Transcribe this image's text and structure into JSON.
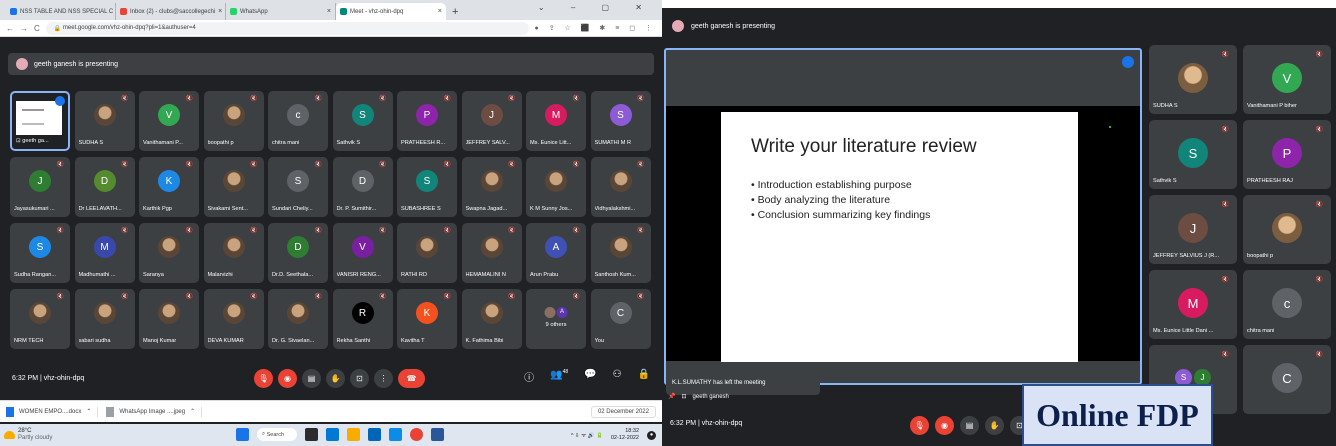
{
  "browser": {
    "tabs": [
      {
        "label": "NSS TABLE AND NSS SPECIAL C",
        "color": "#1a73e8"
      },
      {
        "label": "Inbox (2) - clubs@saccollegechi",
        "color": "#ea4335"
      },
      {
        "label": "WhatsApp",
        "color": "#25d366"
      },
      {
        "label": "Meet - vhz-ohin-dpq",
        "color": "#00897b"
      }
    ],
    "url": "meet.google.com/vhz-ohin-dpq?pli=1&authuser=4"
  },
  "left": {
    "presenting": "geeth ganesh is presenting",
    "presenter_tile": "geeth ga...",
    "tiles": [
      {
        "name": "SUDHA S",
        "initial": "",
        "color": "photo"
      },
      {
        "name": "Vanithamani P...",
        "initial": "V",
        "color": "#33a852"
      },
      {
        "name": "boopathi p",
        "initial": "",
        "color": "photo"
      },
      {
        "name": "chitra mani",
        "initial": "c",
        "color": "#5f6368"
      },
      {
        "name": "Sathvik S",
        "initial": "S",
        "color": "#12857a"
      },
      {
        "name": "PRATHEESH R...",
        "initial": "P",
        "color": "#8e24aa"
      },
      {
        "name": "JEFFREY SALV...",
        "initial": "J",
        "color": "#6d4c41"
      },
      {
        "name": "Ms. Eunice Litt...",
        "initial": "M",
        "color": "#d81b60"
      },
      {
        "name": "SUMATHI M R",
        "initial": "S",
        "color": "#8e5bd6"
      },
      {
        "name": "Jayasukumari ...",
        "initial": "J",
        "color": "#2e7d32"
      },
      {
        "name": "Dr LEELAVATH...",
        "initial": "D",
        "color": "#558b2f"
      },
      {
        "name": "Karthik Pgp",
        "initial": "K",
        "color": "#1e88e5"
      },
      {
        "name": "Sivakami Sent...",
        "initial": "",
        "color": "photo"
      },
      {
        "name": "Sundari Cheliy...",
        "initial": "S",
        "color": "#5f6368"
      },
      {
        "name": "Dr. P. Sumithir...",
        "initial": "D",
        "color": "#5f6368"
      },
      {
        "name": "SUBASHREE S",
        "initial": "S",
        "color": "#12857a"
      },
      {
        "name": "Swapna Jagad...",
        "initial": "",
        "color": "photo"
      },
      {
        "name": "K M Sunny Jos...",
        "initial": "",
        "color": "photo"
      },
      {
        "name": "Vidhyalakshmi...",
        "initial": "",
        "color": "photo"
      },
      {
        "name": "Sudha Rangan...",
        "initial": "S",
        "color": "#1e88e5"
      },
      {
        "name": "Madhumathi ...",
        "initial": "M",
        "color": "#3949ab"
      },
      {
        "name": "Saranya",
        "initial": "",
        "color": "photo"
      },
      {
        "name": "Malarvizhi",
        "initial": "",
        "color": "photo"
      },
      {
        "name": "Dr.D. Seethala...",
        "initial": "D",
        "color": "#2e7d32"
      },
      {
        "name": "VANISRI RENG...",
        "initial": "V",
        "color": "#7b1fa2"
      },
      {
        "name": "RATHI RD",
        "initial": "",
        "color": "photo"
      },
      {
        "name": "HEMAMALINI N",
        "initial": "",
        "color": "photo"
      },
      {
        "name": "Arun Prabu",
        "initial": "A",
        "color": "#3f51b5"
      },
      {
        "name": "Santhosh Kum...",
        "initial": "",
        "color": "photo"
      },
      {
        "name": "NRM TECH",
        "initial": "",
        "color": "photo"
      },
      {
        "name": "sabari sudha",
        "initial": "",
        "color": "photo"
      },
      {
        "name": "Manoj Kumar",
        "initial": "",
        "color": "photo"
      },
      {
        "name": "DEVA KUMAR",
        "initial": "",
        "color": "photo"
      },
      {
        "name": "Dr. G. Sivaelan...",
        "initial": "",
        "color": "photo"
      },
      {
        "name": "Rekha Santhi",
        "initial": "R",
        "color": "#000000"
      },
      {
        "name": "Kavitha T",
        "initial": "K",
        "color": "#f4511e"
      },
      {
        "name": "K. Fathima Bibi",
        "initial": "",
        "color": "photo"
      },
      {
        "name": "9 others",
        "initial": "more",
        "color": ""
      },
      {
        "name": "You",
        "initial": "C",
        "color": "#5f6368"
      }
    ],
    "meeting_info": "6:32 PM  |  vhz-ohin-dpq",
    "participants_badge": "48",
    "downloads": [
      "WOMEN EMPO....docx",
      "WhatsApp Image ....jpeg"
    ],
    "date_chip": "02 December 2022",
    "weather": {
      "temp": "28°C",
      "desc": "Partly cloudy"
    },
    "search": "Search",
    "clock": {
      "time": "18:32",
      "date": "02-12-2022"
    }
  },
  "right": {
    "presenting": "geeth ganesh is presenting",
    "slide": {
      "title": "Write your literature review",
      "bullets": [
        "Introduction establishing purpose",
        "Body analyzing the literature",
        "Conclusion summarizing key findings"
      ]
    },
    "notification": "K.L.SUMATHY has left the meeting",
    "presenter_strip": "geeth ganesh",
    "meeting_info": "6:32 PM  |  vhz-ohin-dpq",
    "tiles": [
      {
        "name": "SUDHA S",
        "initial": "",
        "color": "photo"
      },
      {
        "name": "Vanithamani P biher",
        "initial": "V",
        "color": "#33a852"
      },
      {
        "name": "Sathvik S",
        "initial": "S",
        "color": "#12857a"
      },
      {
        "name": "PRATHEESH RAJ",
        "initial": "P",
        "color": "#8e24aa"
      },
      {
        "name": "JEFFREY SALVIUS J (R...",
        "initial": "J",
        "color": "#6d4c41"
      },
      {
        "name": "boopathi p",
        "initial": "",
        "color": "photo"
      },
      {
        "name": "Ms. Eunice Little Dani ...",
        "initial": "M",
        "color": "#d81b60"
      },
      {
        "name": "chitra mani",
        "initial": "c",
        "color": "#5f6368"
      },
      {
        "name": "",
        "initial": "pair",
        "color": ""
      },
      {
        "name": "",
        "initial": "C",
        "color": "#5f6368"
      }
    ],
    "banner": "Online FDP"
  }
}
